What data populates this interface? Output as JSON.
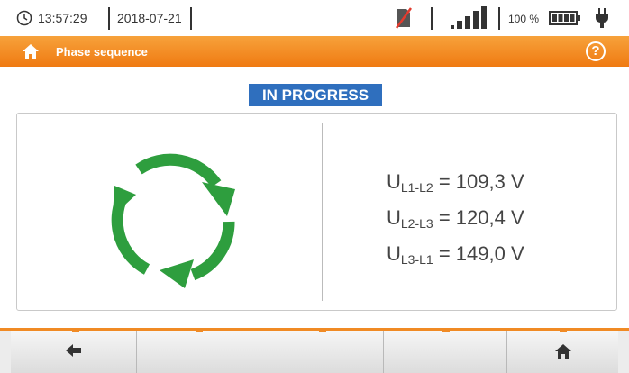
{
  "status_bar": {
    "time": "13:57:29",
    "date": "2018-07-21",
    "battery_percent": "100 %",
    "icons": [
      "clock-icon",
      "no-sim-icon",
      "signal-strength-icon",
      "battery-icon",
      "power-plug-icon"
    ]
  },
  "title_bar": {
    "title": "Phase sequence",
    "icons": [
      "home-icon",
      "help-icon"
    ],
    "help_glyph": "?"
  },
  "status_badge": "IN PROGRESS",
  "measurement": {
    "rotation_icon": "clockwise-rotation-icon",
    "readings": [
      {
        "label": "U",
        "subscript": "L1-L2",
        "value": "= 109,3 V"
      },
      {
        "label": "U",
        "subscript": "L2-L3",
        "value": "= 120,4 V"
      },
      {
        "label": "U",
        "subscript": "L3-L1",
        "value": "= 149,0 V"
      }
    ]
  },
  "toolbar": {
    "buttons": [
      "back-arrow-icon",
      "",
      "",
      "",
      "home-icon"
    ]
  },
  "colors": {
    "accent_orange": "#ef7a12",
    "badge_blue": "#2f6fbe",
    "rotation_green": "#2e9e3e"
  }
}
